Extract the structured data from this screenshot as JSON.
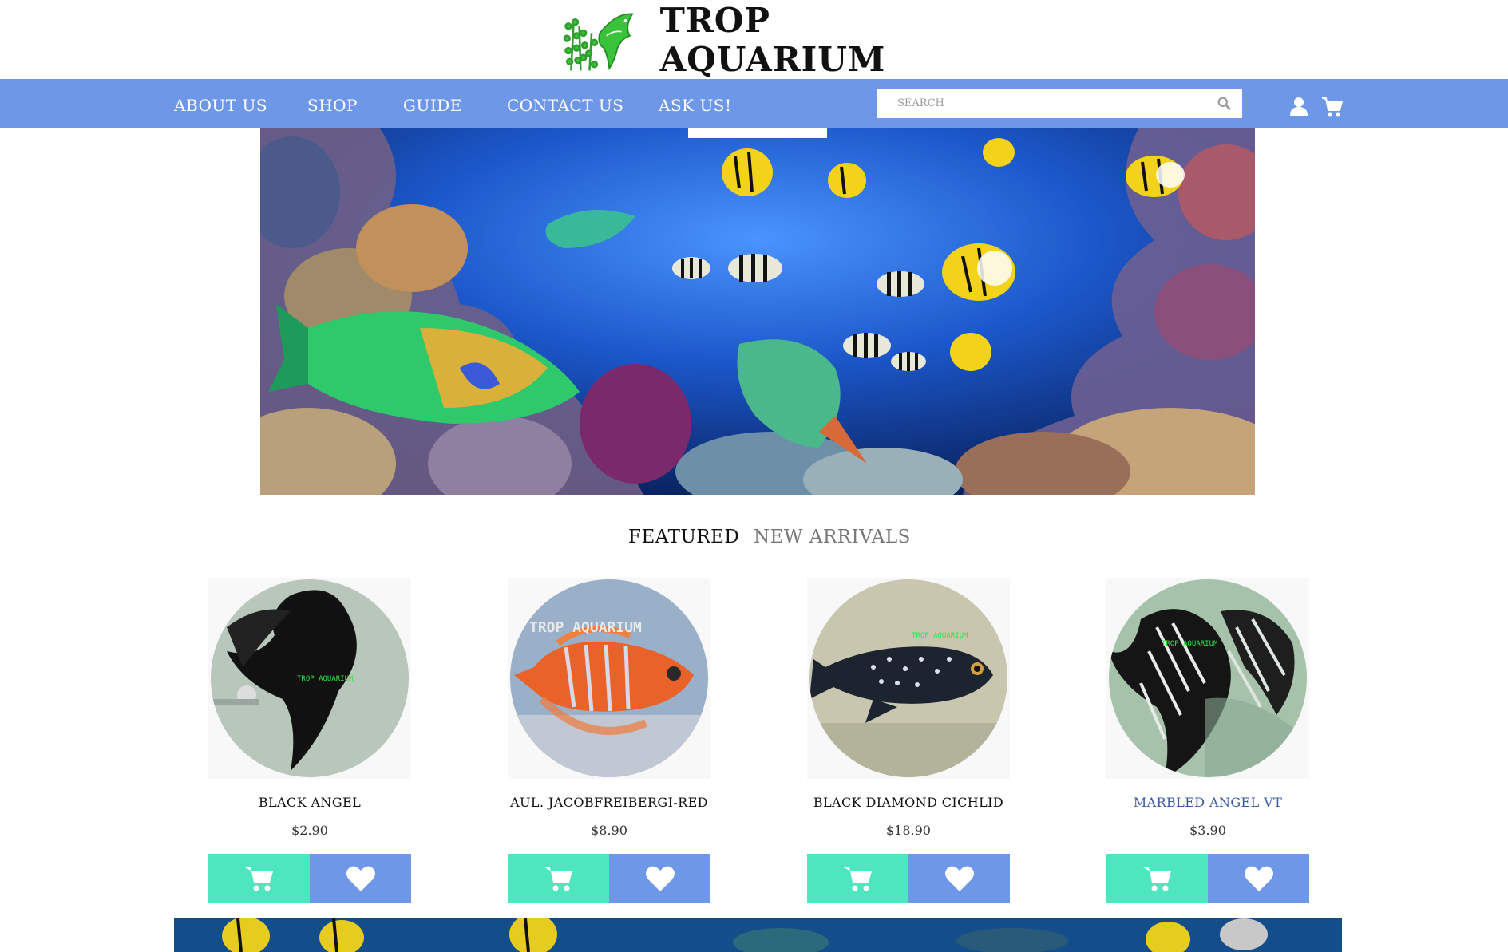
{
  "brand": {
    "name": "TROP AQUARIUM"
  },
  "nav": {
    "items": [
      "ABOUT US",
      "SHOP",
      "GUIDE",
      "CONTACT US",
      "ASK US!"
    ]
  },
  "search": {
    "placeholder": "SEARCH"
  },
  "icons": {
    "search": "search-icon",
    "user": "user-icon",
    "cart": "cart-icon",
    "heart": "heart-icon"
  },
  "tabs": {
    "featured": "FEATURED",
    "new_arrivals": "NEW ARRIVALS"
  },
  "products": [
    {
      "name": "BLACK ANGEL",
      "price": "$2.90",
      "watermark": "TROP AQUARIUM"
    },
    {
      "name": "AUL. JACOBFREIBERGI-RED",
      "price": "$8.90",
      "watermark": "TROP AQUARIUM"
    },
    {
      "name": "BLACK DIAMOND CICHLID",
      "price": "$18.90",
      "watermark": "TROP AQUARIUM"
    },
    {
      "name": "MARBLED ANGEL VT",
      "price": "$3.90",
      "watermark": "TROP AQUARIUM"
    }
  ],
  "colors": {
    "nav_bg": "#6f97e8",
    "cart_button": "#4de6bf",
    "wishlist_button": "#6f97e8",
    "logo_green": "#33b53a",
    "link_blue": "#3b5aa8"
  }
}
